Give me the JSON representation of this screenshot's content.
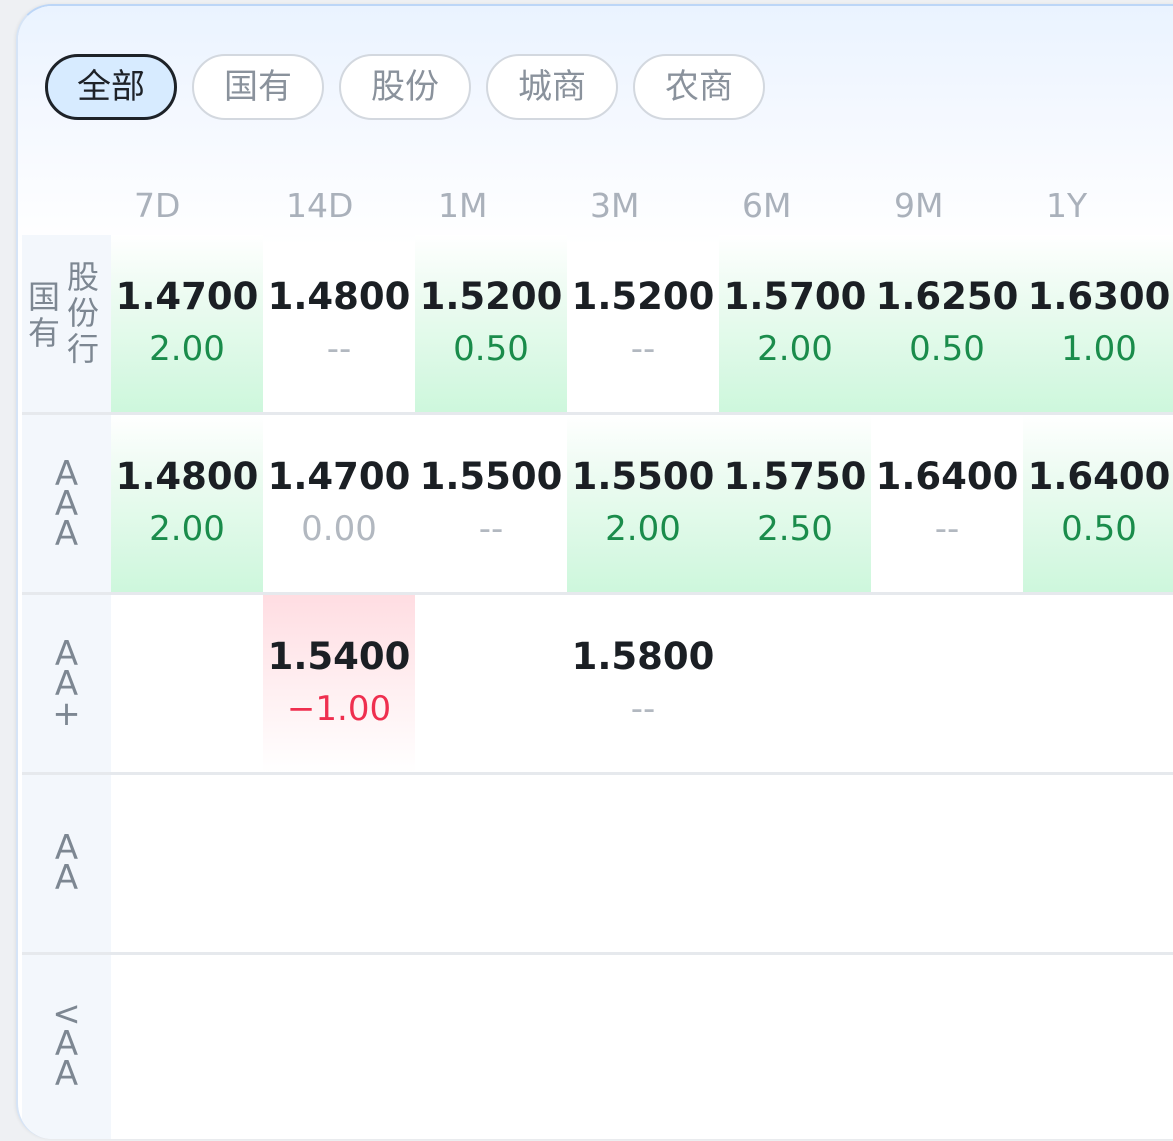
{
  "tabs": [
    {
      "label": "全部",
      "active": true
    },
    {
      "label": "国有",
      "active": false
    },
    {
      "label": "股份",
      "active": false
    },
    {
      "label": "城商",
      "active": false
    },
    {
      "label": "农商",
      "active": false
    }
  ],
  "columns": [
    "7D",
    "14D",
    "1M",
    "3M",
    "6M",
    "9M",
    "1Y"
  ],
  "rows": [
    {
      "label_a": [
        "国",
        "有"
      ],
      "label_b": [
        "股",
        "份",
        "行"
      ],
      "cells": [
        {
          "rate": "1.4700",
          "change": "2.00",
          "dir": "up"
        },
        {
          "rate": "1.4800",
          "change": "--",
          "dir": "none"
        },
        {
          "rate": "1.5200",
          "change": "0.50",
          "dir": "up"
        },
        {
          "rate": "1.5200",
          "change": "--",
          "dir": "none"
        },
        {
          "rate": "1.5700",
          "change": "2.00",
          "dir": "up"
        },
        {
          "rate": "1.6250",
          "change": "0.50",
          "dir": "up"
        },
        {
          "rate": "1.6300",
          "change": "1.00",
          "dir": "up"
        }
      ]
    },
    {
      "label": [
        "A",
        "A",
        "A"
      ],
      "cells": [
        {
          "rate": "1.4800",
          "change": "2.00",
          "dir": "up"
        },
        {
          "rate": "1.4700",
          "change": "0.00",
          "dir": "flat"
        },
        {
          "rate": "1.5500",
          "change": "--",
          "dir": "none"
        },
        {
          "rate": "1.5500",
          "change": "2.00",
          "dir": "up"
        },
        {
          "rate": "1.5750",
          "change": "2.50",
          "dir": "up"
        },
        {
          "rate": "1.6400",
          "change": "--",
          "dir": "none"
        },
        {
          "rate": "1.6400",
          "change": "0.50",
          "dir": "up"
        }
      ]
    },
    {
      "label": [
        "A",
        "A",
        "+"
      ],
      "cells": [
        null,
        {
          "rate": "1.5400",
          "change": "−1.00",
          "dir": "down"
        },
        null,
        {
          "rate": "1.5800",
          "change": "--",
          "dir": "none"
        },
        null,
        null,
        null
      ]
    },
    {
      "label": [
        "A",
        "A"
      ],
      "cells": [
        null,
        null,
        null,
        null,
        null,
        null,
        null
      ]
    },
    {
      "label": [
        "<",
        "A",
        "A"
      ],
      "cells": [
        null,
        null,
        null,
        null,
        null,
        null,
        null
      ]
    }
  ],
  "colors": {
    "up": "#1a8c4b",
    "down": "#ef2f4f",
    "flat": "#b2b8c0",
    "active_tab_bg": "#d7ebff"
  }
}
